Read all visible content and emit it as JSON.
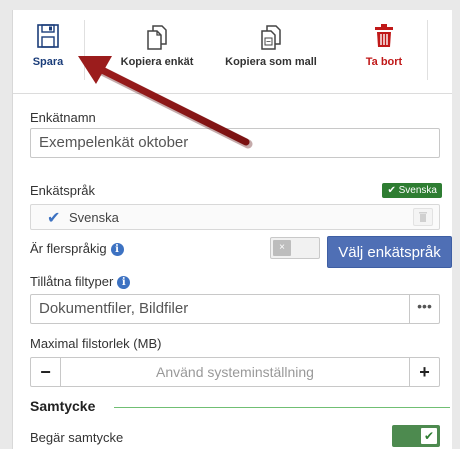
{
  "toolbar": {
    "save_label": "Spara",
    "copy_survey_label": "Kopiera enkät",
    "copy_template_label": "Kopiera som mall",
    "delete_label": "Ta bort"
  },
  "form": {
    "survey_name_label": "Enkätnamn",
    "survey_name_value": "Exempelenkät oktober",
    "survey_language_label": "Enkätspråk",
    "language_badge": "✔ Svenska",
    "language_item": "Svenska",
    "multilingual_label": "Är flerspråkig",
    "choose_language_button": "Välj enkätspråk",
    "allowed_filetypes_label": "Tillåtna filtyper",
    "allowed_filetypes_value": "Dokumentfiler, Bildfiler",
    "max_filesize_label": "Maximal filstorlek (MB)",
    "max_filesize_placeholder": "Använd systeminställning",
    "consent_section_title": "Samtycke",
    "request_consent_label": "Begär samtycke"
  },
  "colors": {
    "primary_button": "#4f6fb5",
    "delete_accent": "#c01919",
    "save_accent": "#1b3d7a",
    "success_green": "#2e7d32",
    "annotation_arrow": "#9b1c1c"
  },
  "icons": {
    "save": "floppy-disk-icon",
    "copy": "copy-documents-icon",
    "copy_template": "copy-template-icon",
    "delete": "trash-icon",
    "info": "info-circle-icon",
    "check": "check-icon",
    "more": "ellipsis-icon",
    "minus": "minus-icon",
    "plus": "plus-icon"
  }
}
